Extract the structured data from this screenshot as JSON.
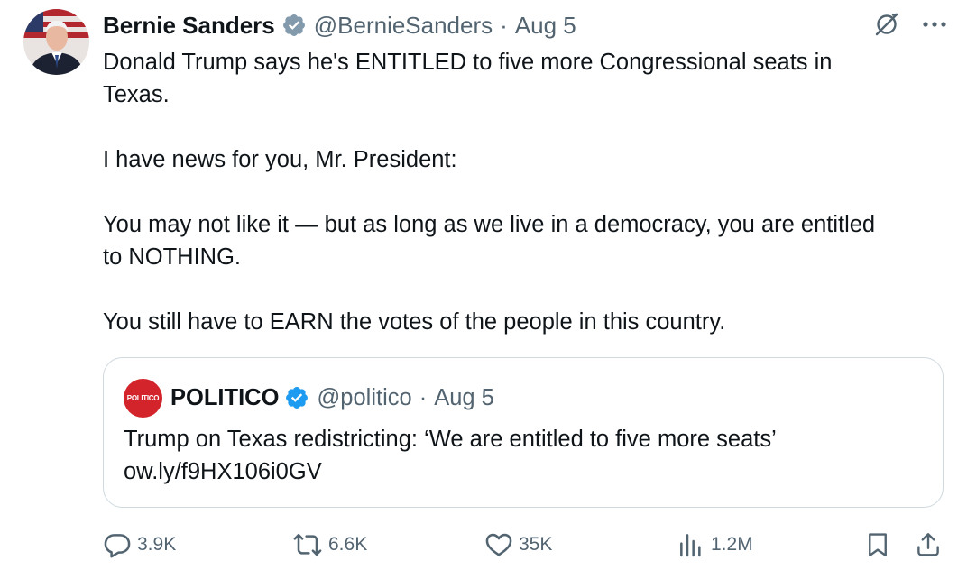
{
  "author": {
    "name": "Bernie Sanders",
    "handle": "@BernieSanders",
    "separator": "·",
    "date": "Aug 5"
  },
  "tweet": {
    "text": "Donald Trump says he's ENTITLED to five more Congressional seats in\nTexas.\n\nI have news for you, Mr. President:\n\nYou may not like it — but as long as we live in a democracy, you are entitled\nto NOTHING.\n\nYou still have to EARN the votes of the people in this country."
  },
  "quote": {
    "avatar_text": "POLITICO",
    "name": "POLITICO",
    "handle": "@politico",
    "separator": "·",
    "date": "Aug 5",
    "text": "Trump on Texas redistricting: ‘We are entitled to five more seats’\now.ly/f9HX106i0GV"
  },
  "actions": {
    "replies": "3.9K",
    "reposts": "6.6K",
    "likes": "35K",
    "views": "1.2M"
  },
  "colors": {
    "text": "#0f1419",
    "muted": "#536471",
    "verified": "#1d9bf0",
    "politico_red": "#d3242b",
    "border": "#cfd9de"
  }
}
